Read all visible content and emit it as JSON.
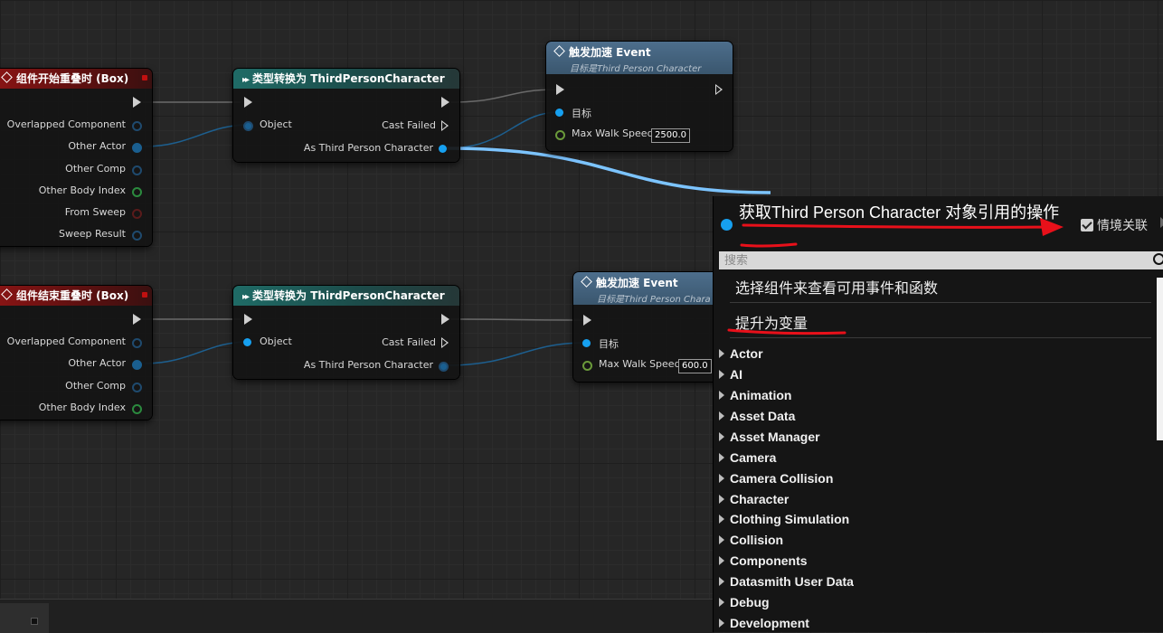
{
  "nodes": {
    "begin_overlap": {
      "title": "组件开始重叠时 (Box)",
      "pins": [
        "Overlapped Component",
        "Other Actor",
        "Other Comp",
        "Other Body Index",
        "From Sweep",
        "Sweep Result"
      ]
    },
    "end_overlap": {
      "title": "组件结束重叠时 (Box)",
      "pins": [
        "Overlapped Component",
        "Other Actor",
        "Other Comp",
        "Other Body Index"
      ]
    },
    "cast_top": {
      "title": "类型转换为 ThirdPersonCharacter",
      "object": "Object",
      "cast_failed": "Cast Failed",
      "as_char": "As Third Person Character"
    },
    "cast_bottom": {
      "title": "类型转换为 ThirdPersonCharacter",
      "object": "Object",
      "cast_failed": "Cast Failed",
      "as_char": "As Third Person Character"
    },
    "event_top": {
      "title": "触发加速 Event",
      "subtitle": "目标是Third Person Character",
      "target": "目标",
      "speed_label": "Max Walk Speed",
      "speed_value": "2500.0"
    },
    "event_bottom": {
      "title": "触发加速 Event",
      "subtitle": "目标是Third Person Chara",
      "target": "目标",
      "speed_label": "Max Walk Speed",
      "speed_value": "600.0"
    }
  },
  "menu": {
    "title": "获取Third Person Character 对象引用的操作",
    "context_label": "情境关联",
    "context_checked": true,
    "search_placeholder": "搜索",
    "hint": "选择组件来查看可用事件和函数",
    "promote": "提升为变量",
    "categories": [
      "Actor",
      "AI",
      "Animation",
      "Asset Data",
      "Asset Manager",
      "Camera",
      "Camera Collision",
      "Character",
      "Clothing Simulation",
      "Collision",
      "Components",
      "Datasmith User Data",
      "Debug",
      "Development"
    ]
  },
  "colors": {
    "object_pin": "#16a0f0",
    "wire_highlight": "#7cc4ff",
    "annotation": "#e8101a"
  }
}
